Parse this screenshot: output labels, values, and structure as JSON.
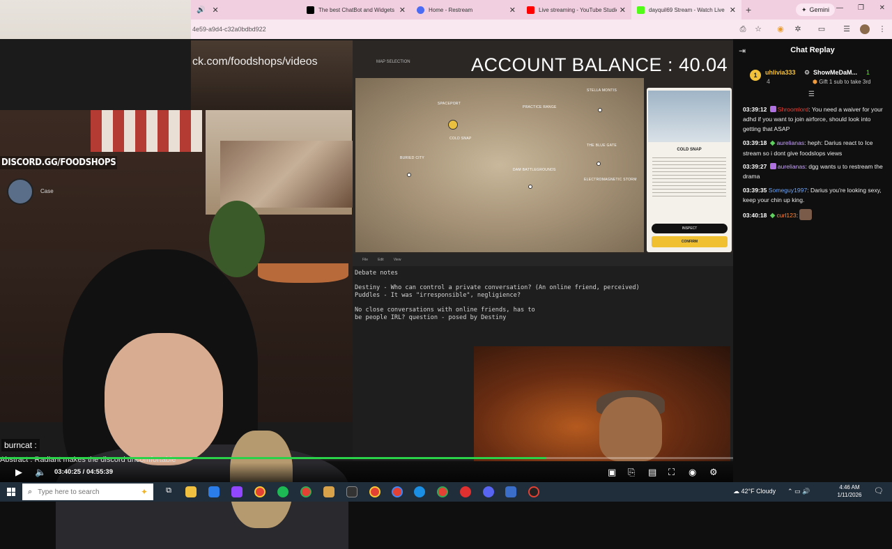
{
  "browser": {
    "tabs": [
      {
        "title": "",
        "favicon_color": "#ffffff",
        "active": false
      },
      {
        "title": "The best ChatBot and Widgets",
        "favicon_color": "#000000",
        "active": false
      },
      {
        "title": "Home - Restream",
        "favicon_color": "#4b6bf5",
        "active": false
      },
      {
        "title": "Live streaming - YouTube Studio",
        "favicon_color": "#ff0000",
        "active": false
      },
      {
        "title": "dayquil69 Stream - Watch Live",
        "favicon_color": "#53fc18",
        "active": true
      }
    ],
    "url": "4e59-a9d4-c32a0bdbd922",
    "gemini_label": "Gemini"
  },
  "stream_overlay": {
    "channel_url": "ck.com/foodshops/videos",
    "discord": "DISCORD.GG/FOODSHOPS",
    "case_label": "Case",
    "burncat_label": "burncat :",
    "ticker": "Abstract : Radiant makes the discord uncomfortable"
  },
  "game": {
    "topbar_label": "MAP SELECTION",
    "account_balance": "ACCOUNT BALANCE : 40.04",
    "locations": [
      "SPACEPORT",
      "PRACTICE RANGE",
      "STELLA MONTIS",
      "COLD SNAP",
      "BURIED CITY",
      "THE BLUE GATE",
      "DAM BATTLEGROUNDS",
      "ELECTROMAGNETIC STORM"
    ],
    "card_title": "COLD SNAP",
    "inspect_label": "INSPECT",
    "confirm_label": "CONFIRM"
  },
  "notes": {
    "menu": [
      "File",
      "Edit",
      "View"
    ],
    "text": "Debate notes\n\nDestiny - Who can control a private conversation? (An online friend, perceived)\nPuddles - It was \"irresponsible\", negligience?\n\nNo close conversations with online friends, has to\nbe people IRL? question - posed by Destiny"
  },
  "player": {
    "current_time": "03:40:25",
    "duration": "04:55:39",
    "time_display": "03:40:25 / 04:55:39",
    "progress_percent": 74.5,
    "accent_color": "#29d249"
  },
  "chat": {
    "title": "Chat Replay",
    "pinned": {
      "rank": "1",
      "user1": "uhlivia333",
      "user1_color": "#f3c23b",
      "user1_count": "4",
      "user2": "ShowMeDaM...",
      "user2_count": "1",
      "gift_text": "Gift 1 sub to take 3rd"
    },
    "messages": [
      {
        "time": "03:39:12",
        "badge": "sub",
        "user": "Shroomlord",
        "color": "#e8443a",
        "text": "You need a waiver for your adhd if you want to join airforce, should look into getting that ASAP"
      },
      {
        "time": "03:39:18",
        "badge": "vip",
        "user": "aurelianas",
        "color": "#c7a6f5",
        "text": "heph: Darius react to Ice stream so i dont give foodslops views"
      },
      {
        "time": "03:39:27",
        "badge": "sub",
        "user": "aurelianas",
        "color": "#c7a6f5",
        "text": "dgg wants u to restream the drama"
      },
      {
        "time": "03:39:35",
        "badge": "",
        "user": "Someguy1997",
        "color": "#6fa8ff",
        "text": "Darius you're looking sexy, keep your chin up king."
      },
      {
        "time": "03:40:18",
        "badge": "vip",
        "user": "curl123",
        "color": "#ff8a3d",
        "text": ""
      }
    ]
  },
  "taskbar": {
    "search_placeholder": "Type here to search",
    "weather": "42°F  Cloudy",
    "time": "4:46 AM",
    "date": "1/11/2026"
  }
}
